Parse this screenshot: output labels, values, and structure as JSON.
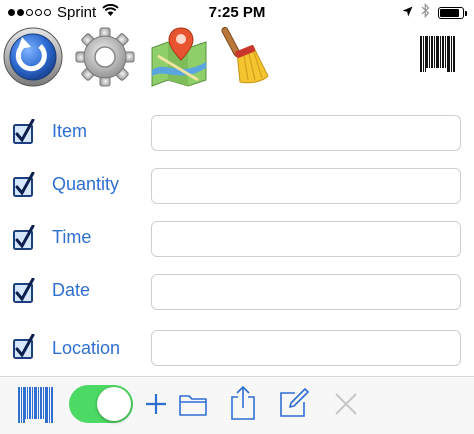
{
  "status_bar": {
    "carrier": "Sprint",
    "time": "7:25 PM",
    "signal_bars_filled": 2,
    "signal_bars_total": 5,
    "battery_level": 0.85
  },
  "top_toolbar": {
    "icons": [
      "sync-icon",
      "gear-icon",
      "map-icon",
      "broom-icon",
      "barcode-icon"
    ]
  },
  "form": {
    "fields": [
      {
        "label": "Item",
        "checked": true,
        "value": ""
      },
      {
        "label": "Quantity",
        "checked": true,
        "value": ""
      },
      {
        "label": "Time",
        "checked": true,
        "value": ""
      },
      {
        "label": "Date",
        "checked": true,
        "value": ""
      },
      {
        "label": "Location",
        "checked": true,
        "value": ""
      }
    ]
  },
  "bottom_toolbar": {
    "toggle_on": true,
    "icons": [
      "barcode-icon",
      "plus-icon",
      "folder-icon",
      "share-icon",
      "edit-icon",
      "close-icon"
    ]
  },
  "colors": {
    "accent": "#2f6fd2",
    "toggle_on": "#4cd964",
    "toolbar_bg": "#f7f7f7",
    "input_border": "#cfcfcf"
  }
}
